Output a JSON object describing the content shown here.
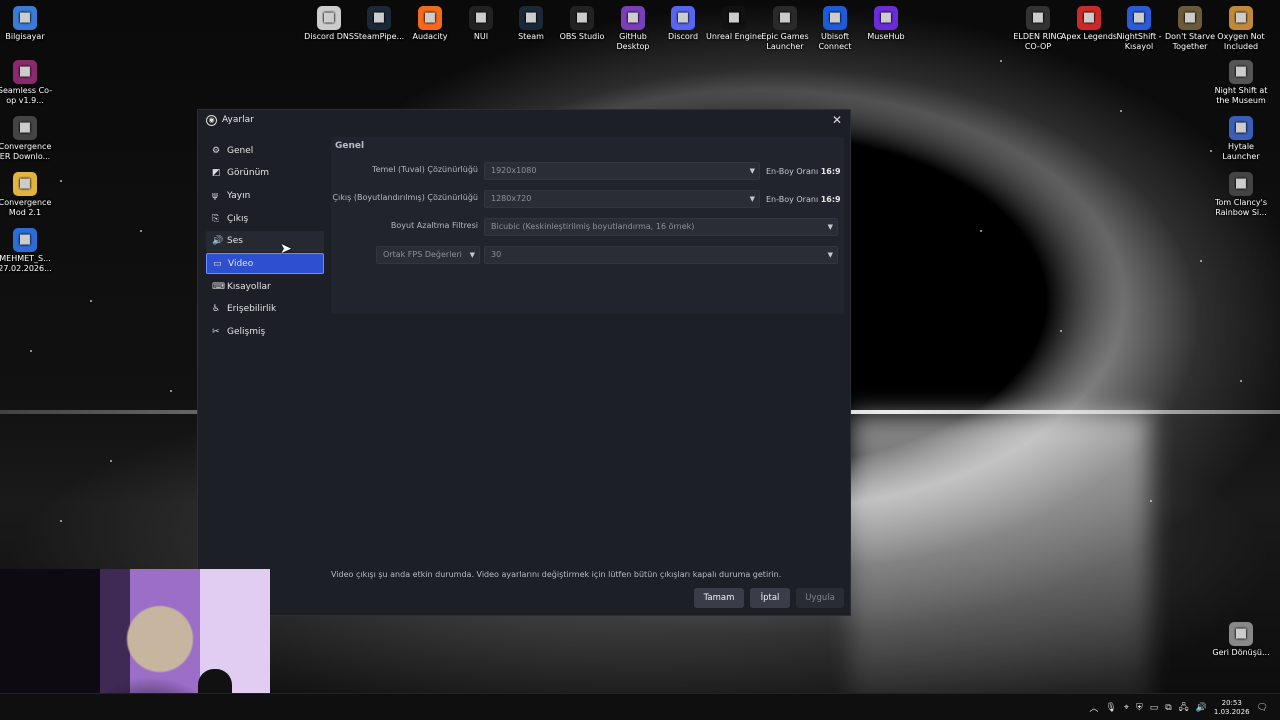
{
  "desktop": {
    "left_icons": [
      {
        "label": "Bilgisayar",
        "icon": "computer-icon",
        "color": "#3a7bd5"
      },
      {
        "label": "Seamless Co-op v1.9...",
        "icon": "winrar-icon",
        "color": "#8b2a6a"
      },
      {
        "label": "Convergence ER Downlo...",
        "icon": "convergence-icon",
        "color": "#444"
      },
      {
        "label": "Convergence Mod 2.1",
        "icon": "folder-icon",
        "color": "#e3b341"
      },
      {
        "label": "MEHMET_S... 27.02.2026...",
        "icon": "document-icon",
        "color": "#2b6cd6"
      }
    ],
    "top_icons": [
      {
        "label": "Discord DNS",
        "icon": "file-icon",
        "color": "#ccc"
      },
      {
        "label": "SteamPipe...",
        "icon": "steam-icon",
        "color": "#1b2838"
      },
      {
        "label": "Audacity",
        "icon": "audacity-icon",
        "color": "#f26a1b"
      },
      {
        "label": "NUI",
        "icon": "nui-icon",
        "color": "#222"
      },
      {
        "label": "Steam",
        "icon": "steam-icon",
        "color": "#1b2838"
      },
      {
        "label": "OBS Studio",
        "icon": "obs-icon",
        "color": "#222"
      },
      {
        "label": "GitHub Desktop",
        "icon": "github-icon",
        "color": "#7a3fb8"
      },
      {
        "label": "Discord",
        "icon": "discord-icon",
        "color": "#5865f2"
      },
      {
        "label": "Unreal Engine",
        "icon": "unreal-icon",
        "color": "#111"
      },
      {
        "label": "Epic Games Launcher",
        "icon": "epic-icon",
        "color": "#2a2a2a"
      },
      {
        "label": "Ubisoft Connect",
        "icon": "ubisoft-icon",
        "color": "#1e5bd8"
      },
      {
        "label": "MuseHub",
        "icon": "musehub-icon",
        "color": "#6a2bd8"
      }
    ],
    "right_icons": [
      {
        "label": "ELDEN RING CO-OP",
        "icon": "eldenring-icon",
        "color": "#333"
      },
      {
        "label": "Apex Legends",
        "icon": "apex-icon",
        "color": "#cc2a2a"
      },
      {
        "label": "NightShift - Kısayol",
        "icon": "nightshift-icon",
        "color": "#2a5bd8"
      },
      {
        "label": "Don't Starve Together",
        "icon": "dst-icon",
        "color": "#6b5a3a"
      },
      {
        "label": "Oxygen Not Included",
        "icon": "oni-icon",
        "color": "#c0893a"
      },
      {
        "label": "Night Shift at the Museum",
        "icon": "museum-icon",
        "color": "#555"
      },
      {
        "label": "Hytale Launcher",
        "icon": "hytale-icon",
        "color": "#3a5fb8"
      },
      {
        "label": "Tom Clancy's Rainbow Si...",
        "icon": "rainbow-icon",
        "color": "#444"
      },
      {
        "label": "Geri Dönüşü...",
        "icon": "recycle-bin-icon",
        "color": "#888"
      }
    ]
  },
  "window": {
    "title": "Ayarlar",
    "close_glyph": "✕",
    "sidebar": [
      {
        "label": "Genel",
        "icon": "gear-icon",
        "glyph": "⚙"
      },
      {
        "label": "Görünüm",
        "icon": "appearance-icon",
        "glyph": "◩"
      },
      {
        "label": "Yayın",
        "icon": "antenna-icon",
        "glyph": "ψ"
      },
      {
        "label": "Çıkış",
        "icon": "output-icon",
        "glyph": "⎘"
      },
      {
        "label": "Ses",
        "icon": "speaker-icon",
        "glyph": "🔊"
      },
      {
        "label": "Video",
        "icon": "monitor-icon",
        "glyph": "▭"
      },
      {
        "label": "Kısayollar",
        "icon": "keyboard-icon",
        "glyph": "⌨"
      },
      {
        "label": "Erişebilirlik",
        "icon": "accessibility-icon",
        "glyph": "♿"
      },
      {
        "label": "Gelişmiş",
        "icon": "tools-icon",
        "glyph": "✂"
      }
    ],
    "active_index": 5,
    "hover_index": 4,
    "section_title": "Genel",
    "base_resolution": {
      "label": "Temel (Tuval) Çözünürlüğü",
      "value": "1920x1080",
      "aspect_label": "En-Boy Oranı",
      "aspect_value": "16:9"
    },
    "output_resolution": {
      "label": "Çıkış (Boyutlandırılmış) Çözünürlüğü",
      "value": "1280x720",
      "aspect_label": "En-Boy Oranı",
      "aspect_value": "16:9"
    },
    "downscale_filter": {
      "label": "Boyut Azaltma Filtresi",
      "value": "Bicubic (Keskinleştirilmiş boyutlandırma, 16 örnek)"
    },
    "fps": {
      "mode": "Ortak FPS Değerleri",
      "value": "30"
    },
    "notice": "Video çıkışı şu anda etkin durumda. Video ayarlarını değiştirmek için lütfen bütün çıkışları kapalı duruma getirin.",
    "buttons": {
      "ok": "Tamam",
      "cancel": "İptal",
      "apply": "Uygula"
    }
  },
  "taskbar": {
    "time": "20:53",
    "date": "1.03.2026"
  }
}
